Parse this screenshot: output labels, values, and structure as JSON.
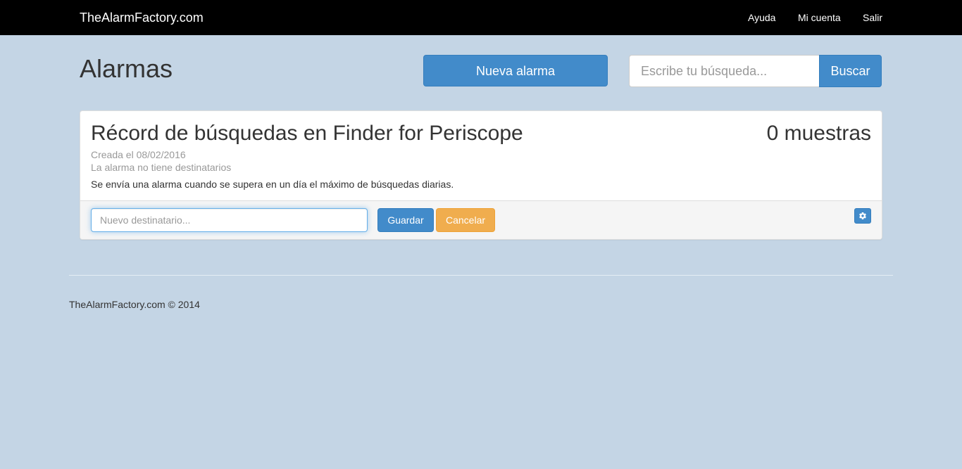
{
  "navbar": {
    "brand": "TheAlarmFactory.com",
    "links": [
      {
        "label": "Ayuda"
      },
      {
        "label": "Mi cuenta"
      },
      {
        "label": "Salir"
      }
    ]
  },
  "header": {
    "title": "Alarmas",
    "new_alarm_label": "Nueva alarma",
    "search_placeholder": "Escribe tu búsqueda...",
    "search_value": "",
    "search_button": "Buscar"
  },
  "alarm": {
    "title": "Récord de búsquedas en Finder for Periscope",
    "samples": "0 muestras",
    "created": "Creada el 08/02/2016",
    "recipients_status": "La alarma no tiene destinatarios",
    "description": "Se envía una alarma cuando se supera en un día el máximo de búsquedas diarias.",
    "recipient_placeholder": "Nuevo destinatario...",
    "recipient_value": "",
    "save_label": "Guardar",
    "cancel_label": "Cancelar",
    "settings_icon": "gear-icon"
  },
  "footer": {
    "text": "TheAlarmFactory.com © 2014"
  },
  "colors": {
    "background": "#c4d5e5",
    "navbar": "#000000",
    "primary": "#428bca",
    "warning": "#f0ad4e"
  }
}
